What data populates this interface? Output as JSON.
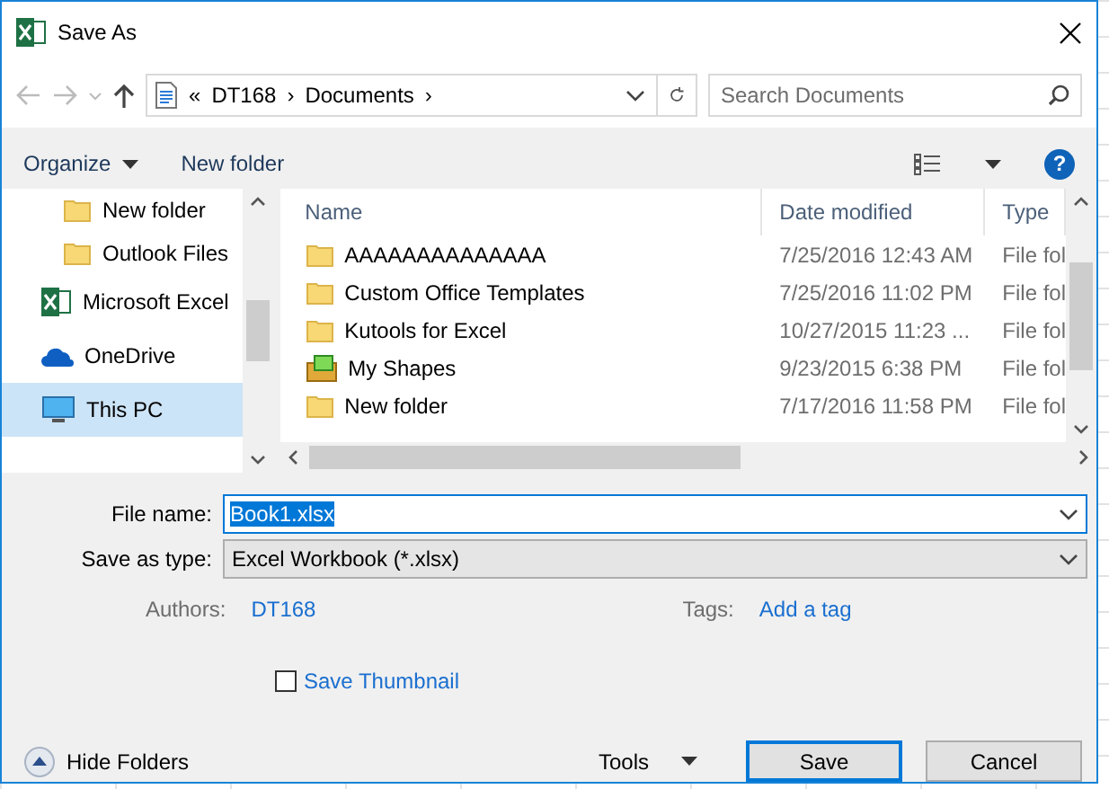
{
  "window": {
    "title": "Save As"
  },
  "address": {
    "overflow": "«",
    "crumbs": [
      "DT168",
      "Documents"
    ],
    "separator": "›"
  },
  "search": {
    "placeholder": "Search Documents"
  },
  "toolbar": {
    "organize": "Organize",
    "new_folder": "New folder",
    "help": "?"
  },
  "sidebar": {
    "items": [
      {
        "label": "New folder",
        "kind": "folder",
        "indented": true,
        "selected": false
      },
      {
        "label": "Outlook Files",
        "kind": "folder",
        "indented": true,
        "selected": false
      },
      {
        "label": "Microsoft Excel",
        "kind": "excel",
        "indented": false,
        "selected": false
      },
      {
        "label": "OneDrive",
        "kind": "cloud",
        "indented": false,
        "selected": false
      },
      {
        "label": "This PC",
        "kind": "pc",
        "indented": false,
        "selected": true
      }
    ]
  },
  "table": {
    "columns": [
      "Name",
      "Date modified",
      "Type"
    ],
    "rows": [
      {
        "kind": "folder",
        "name": "AAAAAAAAAAAAAA",
        "date": "7/25/2016 12:43 AM",
        "type": "File fol"
      },
      {
        "kind": "folder",
        "name": "Custom Office Templates",
        "date": "7/25/2016 11:02 PM",
        "type": "File fol"
      },
      {
        "kind": "folder",
        "name": "Kutools for Excel",
        "date": "10/27/2015 11:23 ...",
        "type": "File fol"
      },
      {
        "kind": "shapes",
        "name": "My Shapes",
        "date": "9/23/2015 6:38 PM",
        "type": "File fol"
      },
      {
        "kind": "folder",
        "name": "New folder",
        "date": "7/17/2016 11:58 PM",
        "type": "File fol"
      }
    ]
  },
  "form": {
    "file_name_label": "File name:",
    "file_name": "Book1.xlsx",
    "type_label": "Save as type:",
    "type_value": "Excel Workbook (*.xlsx)",
    "authors_label": "Authors:",
    "authors": "DT168",
    "tags_label": "Tags:",
    "tags": "Add a tag",
    "thumbnail": {
      "label": "Save Thumbnail",
      "checked": false
    }
  },
  "footer": {
    "hide_folders": "Hide Folders",
    "tools": "Tools",
    "buttons": [
      {
        "label": "Save",
        "default": true
      },
      {
        "label": "Cancel",
        "default": false
      }
    ]
  }
}
